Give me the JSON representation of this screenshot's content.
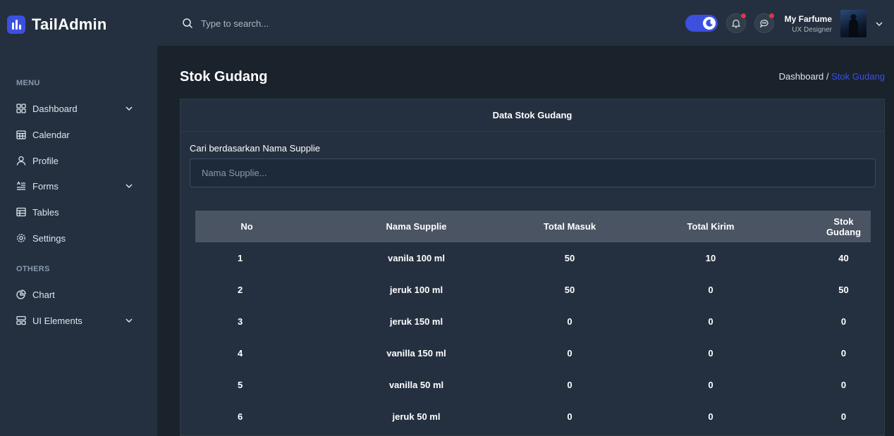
{
  "app": {
    "name": "TailAdmin"
  },
  "sidebar": {
    "menu_label": "MENU",
    "others_label": "OTHERS",
    "items": [
      {
        "label": "Dashboard",
        "icon": "grid-icon"
      },
      {
        "label": "Calendar",
        "icon": "calendar-icon"
      },
      {
        "label": "Profile",
        "icon": "user-icon"
      },
      {
        "label": "Forms",
        "icon": "form-icon"
      },
      {
        "label": "Tables",
        "icon": "table-icon"
      },
      {
        "label": "Settings",
        "icon": "gear-icon"
      }
    ],
    "others": [
      {
        "label": "Chart",
        "icon": "pie-chart-icon"
      },
      {
        "label": "UI Elements",
        "icon": "layout-icon"
      }
    ]
  },
  "header": {
    "search_placeholder": "Type to search...",
    "user_name": "My Farfume",
    "user_role": "UX Designer"
  },
  "page": {
    "title": "Stok Gudang",
    "breadcrumb": {
      "parent": "Dashboard /",
      "current": "Stok Gudang"
    }
  },
  "card": {
    "title": "Data Stok Gudang",
    "filter_label": "Cari berdasarkan Nama Supplie",
    "filter_placeholder": "Nama Supplie..."
  },
  "table": {
    "columns": [
      "No",
      "Nama Supplie",
      "Total Masuk",
      "Total Kirim",
      "Stok Gudang"
    ],
    "rows": [
      [
        "1",
        "vanila 100 ml",
        "50",
        "10",
        "40"
      ],
      [
        "2",
        "jeruk 100 ml",
        "50",
        "0",
        "50"
      ],
      [
        "3",
        "jeruk 150 ml",
        "0",
        "0",
        "0"
      ],
      [
        "4",
        "vanilla 150 ml",
        "0",
        "0",
        "0"
      ],
      [
        "5",
        "vanilla 50 ml",
        "0",
        "0",
        "0"
      ],
      [
        "6",
        "jeruk 50 ml",
        "0",
        "0",
        "0"
      ]
    ]
  },
  "colors": {
    "accent": "#3c50e0",
    "sidebar_bg": "#24303f",
    "body_bg": "#1a222c",
    "notify": "#dc3545"
  }
}
